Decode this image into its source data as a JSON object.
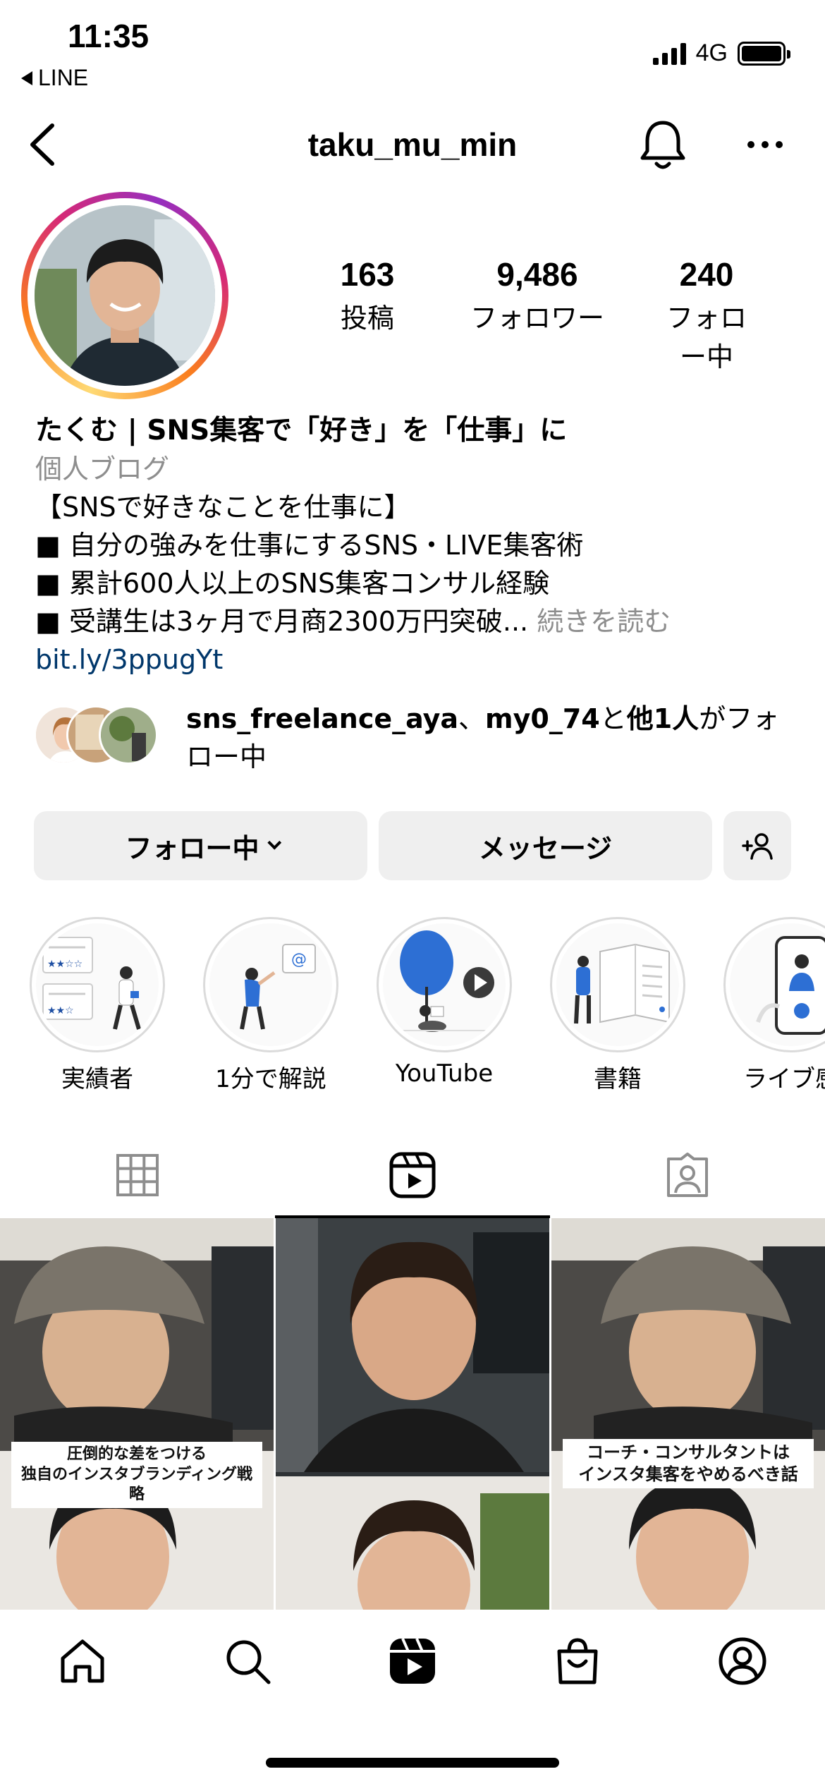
{
  "status_bar": {
    "time": "11:35",
    "back_app": "LINE",
    "network": "4G"
  },
  "header": {
    "username": "taku_mu_min"
  },
  "profile": {
    "stats": [
      {
        "value": "163",
        "label": "投稿"
      },
      {
        "value": "9,486",
        "label": "フォロワー"
      },
      {
        "value": "240",
        "label": "フォロー中"
      }
    ],
    "name": "たくむ | SNS集客で「好き」を「仕事」に",
    "category": "個人ブログ",
    "bio_lines": [
      "【SNSで好きなことを仕事に】",
      "■ 自分の強みを仕事にするSNS・LIVE集客術",
      "■ 累計600人以上のSNS集客コンサル経験",
      "■ 受講生は3ヶ月で月商2300万円突破..."
    ],
    "more_label": "続きを読む",
    "link": "bit.ly/3ppugYt"
  },
  "followed_by": {
    "user1": "sns_freelance_aya",
    "sep": "、",
    "user2": "my0_74",
    "and": "と",
    "others": "他1人",
    "suffix": "がフォ",
    "line2": "ロー中"
  },
  "actions": {
    "following_label": "フォロー中",
    "message_label": "メッセージ"
  },
  "highlights": [
    {
      "label": "実績者",
      "icon": "review-stars-illustration"
    },
    {
      "label": "1分で解説",
      "icon": "email-illustration"
    },
    {
      "label": "YouTube",
      "icon": "tree-play-illustration"
    },
    {
      "label": "書籍",
      "icon": "book-illustration"
    },
    {
      "label": "ライブ感",
      "icon": "phone-live-illustration"
    }
  ],
  "tabs": [
    {
      "name": "grid",
      "icon": "grid-icon"
    },
    {
      "name": "reels",
      "icon": "reels-icon",
      "active": true
    },
    {
      "name": "tagged",
      "icon": "tagged-icon"
    }
  ],
  "posts": [
    {
      "caption_lines": [
        "圧倒的な差をつける",
        "独自のインスタブランディング戦略"
      ]
    },
    {
      "caption_lines": []
    },
    {
      "caption_lines": [
        "コーチ・コンサルタントは",
        "インスタ集客をやめるべき話"
      ]
    }
  ],
  "bottom_nav": [
    "home-icon",
    "search-icon",
    "reels-icon",
    "shop-icon",
    "profile-icon"
  ],
  "colors": {
    "accent_link": "#00376b",
    "secondary_text": "#8e8e8e",
    "button_bg": "#efefef"
  }
}
